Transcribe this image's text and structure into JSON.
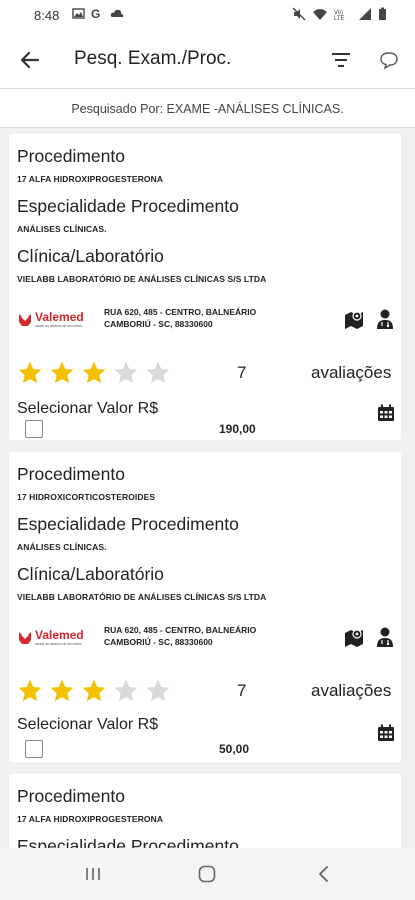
{
  "status_bar": {
    "time": "8:48",
    "left_icons": [
      "image-icon",
      "google-icon",
      "cloud-icon"
    ],
    "right_icons": [
      "mute-icon",
      "wifi-icon",
      "volte-icon",
      "signal-icon",
      "battery-icon"
    ]
  },
  "app_bar": {
    "title": "Pesq. Exam./Proc.",
    "icons": [
      "back-arrow-icon",
      "filter-icon",
      "chat-icon"
    ]
  },
  "search_info": "Pesquisado Por: EXAME -ANÁLISES CLÍNICAS.",
  "labels": {
    "procedimento": "Procedimento",
    "especialidade": "Especialidade Procedimento",
    "clinica": "Clínica/Laboratório",
    "avaliacoes": "avaliações",
    "selecionar": "Selecionar  Valor R$"
  },
  "brand": {
    "logo_text": "Valemed",
    "logo_tagline": "saúde ao alcance de seu bolso",
    "color": "#d7262c"
  },
  "star_color": "#f2c200",
  "star_empty_color": "#d9d9d9",
  "results": [
    {
      "procedimento": "17 ALFA HIDROXIPROGESTERONA",
      "especialidade": "ANÁLISES CLÍNICAS.",
      "clinica": "VIELABB LABORATÓRIO DE ANÁLISES CLÍNICAS S/S LTDA",
      "endereco_l1": "RUA 620, 485 - CENTRO, BALNEÁRIO",
      "endereco_l2": "CAMBORIÚ - SC, 88330600",
      "rating": 3,
      "avaliacoes_count": "7",
      "valor": "190,00",
      "selecionado": false
    },
    {
      "procedimento": "17 HIDROXICORTICOSTEROIDES",
      "especialidade": "ANÁLISES CLÍNICAS.",
      "clinica": "VIELABB LABORATÓRIO DE ANÁLISES CLÍNICAS S/S LTDA",
      "endereco_l1": "RUA 620, 485 - CENTRO, BALNEÁRIO",
      "endereco_l2": "CAMBORIÚ - SC, 88330600",
      "rating": 3,
      "avaliacoes_count": "7",
      "valor": "50,00",
      "selecionado": false
    },
    {
      "procedimento": "17 ALFA HIDROXIPROGESTERONA",
      "especialidade": "",
      "clinica": "",
      "endereco_l1": "",
      "endereco_l2": "",
      "rating": 0,
      "avaliacoes_count": "",
      "valor": "",
      "selecionado": false
    }
  ],
  "nav_bar": {
    "icons": [
      "recent-apps-icon",
      "home-icon",
      "back-icon"
    ]
  }
}
